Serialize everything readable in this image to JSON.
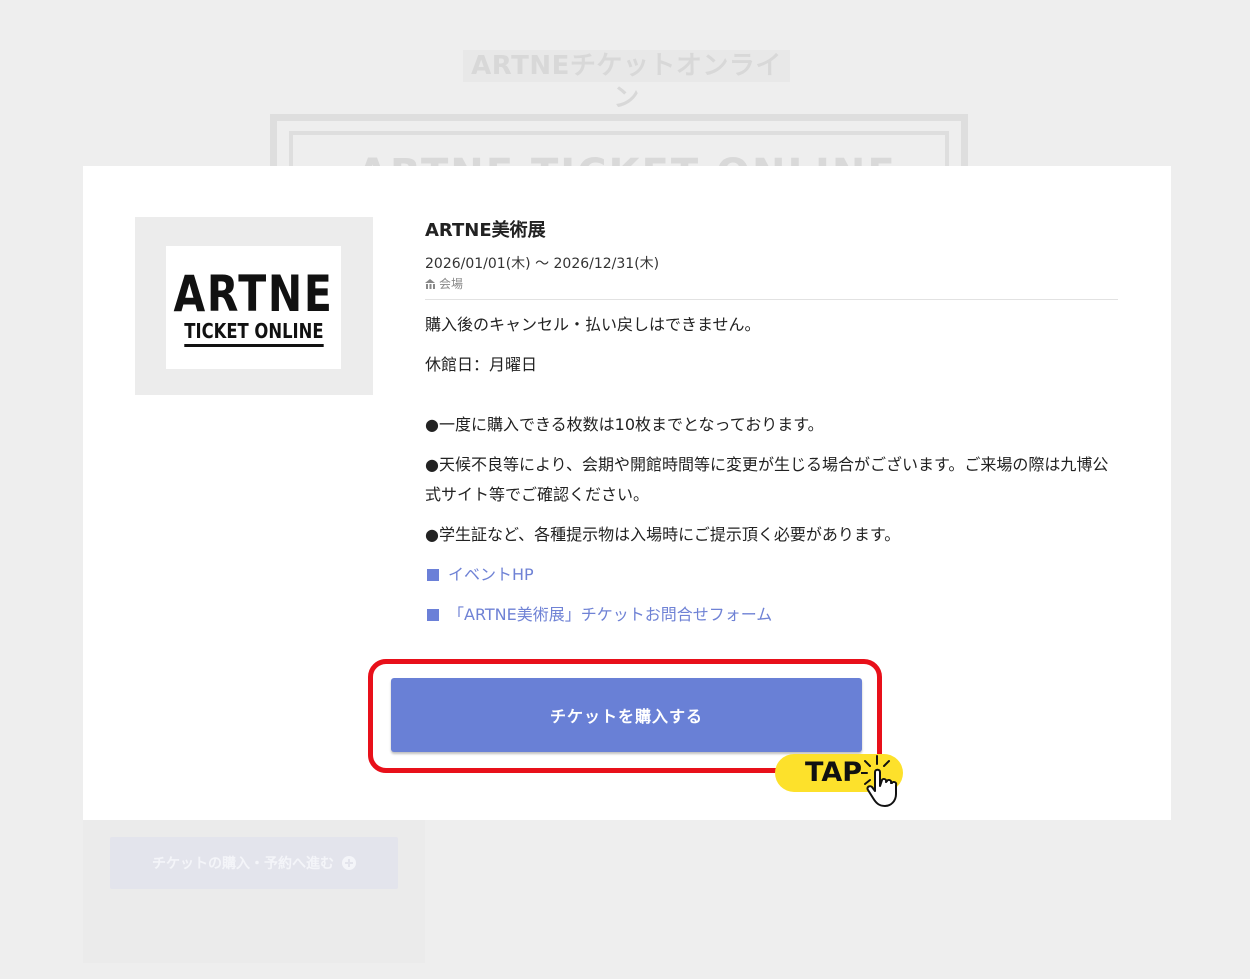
{
  "background": {
    "page_title": "ARTNEチケットオンライン",
    "banner_text": "ARTNE TICKET ONLINE",
    "buy_button_label": "チケットの購入・予約へ進む"
  },
  "event": {
    "logo_main": "ARTNE",
    "logo_sub": "TICKET ONLINE",
    "title": "ARTNE美術展",
    "dates": "2026/01/01(木) ～ 2026/12/31(木)",
    "venue": "会場"
  },
  "description": [
    "購入後のキャンセル・払い戻しはできません。",
    "休館日：月曜日",
    "●一度に購入できる枚数は10枚までとなっております。",
    "●天候不良等により、会期や開館時間等に変更が生じる場合がございます。ご来場の際は九博公式サイト等でご確認ください。",
    "●学生証など、各種提示物は入場時にご提示頂く必要があります。"
  ],
  "links": [
    {
      "label": "イベントHP"
    },
    {
      "label": "「ARTNE美術展」チケットお問合せフォーム"
    }
  ],
  "cta": {
    "buy_label": "チケットを購入する",
    "tap_label": "TAP"
  },
  "colors": {
    "accent": "#6980d6",
    "link": "#6f82d5",
    "highlight": "#e8101a",
    "tap_badge": "#fde12b"
  }
}
